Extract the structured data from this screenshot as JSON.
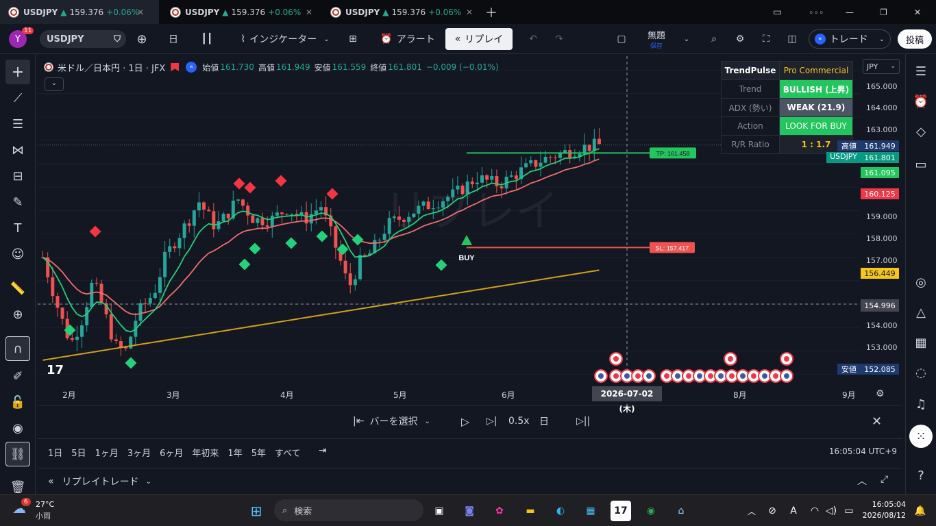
{
  "tabs": [
    {
      "symbol": "USDJPY",
      "price": "159.376",
      "change": "+0.06%"
    },
    {
      "symbol": "USDJPY",
      "price": "159.376",
      "change": "+0.06%"
    },
    {
      "symbol": "USDJPY",
      "price": "159.376",
      "change": "+0.06%"
    }
  ],
  "toolbar": {
    "avatar": "Y",
    "avatar_badge": "11",
    "symbol": "USDJPY",
    "interval": "日",
    "indicators": "インジケーター",
    "alert": "アラート",
    "replay": "リプレイ",
    "layout_title": "無題",
    "layout_sub": "保存",
    "trade": "トレード",
    "publish": "投稿"
  },
  "legend": {
    "name": "米ドル／日本円 · 1日 · JFX",
    "open_label": "始値",
    "open": "161.730",
    "high_label": "高値",
    "high": "161.949",
    "low_label": "安値",
    "low": "161.559",
    "close_label": "終値",
    "close": "161.801",
    "change": "−0.009 (−0.01%)"
  },
  "trendpulse": {
    "title": "TrendPulse",
    "edition": "Pro Commercial",
    "rows": [
      {
        "label": "Trend",
        "value": "BULLISH (上昇)",
        "color": "#22c55e"
      },
      {
        "label": "ADX (勢い)",
        "value": "WEAK (21.9)",
        "color": "#4b5563"
      },
      {
        "label": "Action",
        "value": "LOOK FOR BUY",
        "color": "#22c55e"
      },
      {
        "label": "R/R Ratio",
        "value": "1 : 1.7",
        "color": "#1e222d"
      }
    ]
  },
  "currency": "JPY",
  "price_axis": {
    "ticks": [
      "165.000",
      "164.000",
      "163.000",
      "159.000",
      "158.000",
      "157.000",
      "154.000",
      "153.000"
    ],
    "high_label": "高値",
    "high": "161.949",
    "symbol_label": "USDJPY",
    "current": "161.801",
    "ema_fast": "161.095",
    "ema_slow": "160.125",
    "ema_long": "156.449",
    "crosshair": "154.996",
    "low_label": "安値",
    "low": "152.085"
  },
  "time_axis": {
    "months": [
      "2月",
      "3月",
      "4月",
      "5月",
      "6月",
      "8月",
      "9月"
    ],
    "crosshair_date": "2026-07-02 (木)"
  },
  "annotations": {
    "tp": "TP: 161.458",
    "sl": "SL: 157.417",
    "buy": "BUY",
    "watermark": "リプレイ"
  },
  "replay_controls": {
    "select_bar": "バーを選択",
    "speed": "0.5x",
    "interval": "日"
  },
  "ranges": [
    "1日",
    "5日",
    "1ヶ月",
    "3ヶ月",
    "6ヶ月",
    "年初来",
    "1年",
    "5年",
    "すべて"
  ],
  "clock": "16:05:04 UTC+9",
  "bottom_panel": {
    "title": "リプレイトレード"
  },
  "taskbar": {
    "weather_temp": "27°C",
    "weather_desc": "小雨",
    "weather_badge": "6",
    "search": "検索",
    "time": "16:05:04",
    "date": "2026/08/12"
  },
  "chart_data": {
    "type": "candlestick",
    "x_range": [
      "2026-01-22",
      "2026-07-02"
    ],
    "ylim": [
      151.6,
      165.6
    ],
    "tp": 161.458,
    "sl": 157.417,
    "crosshair_price": 154.996,
    "candles": [],
    "lines": []
  }
}
